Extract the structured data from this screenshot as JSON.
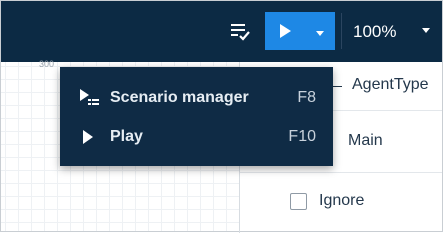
{
  "colors": {
    "toolbar_bg": "#0c2a44",
    "accent": "#1e88e5",
    "menu_bg": "#0f2b45",
    "text_dark": "#24384c"
  },
  "toolbar": {
    "checklist_icon": "checklist-icon",
    "run_icon": "play-icon",
    "run_dropdown_icon": "caret-down-icon",
    "zoom": "100%",
    "zoom_dropdown_icon": "caret-down-icon"
  },
  "canvas": {
    "ruler_label": "300"
  },
  "panel": {
    "agent_type_label": "AgentType",
    "main_label": "Main",
    "ignore_label": "Ignore",
    "ignore_checked": false
  },
  "run_menu": {
    "items": [
      {
        "label": "Scenario manager",
        "shortcut": "F8",
        "icon": "scenario-manager-icon"
      },
      {
        "label": "Play",
        "shortcut": "F10",
        "icon": "play-icon"
      }
    ]
  }
}
